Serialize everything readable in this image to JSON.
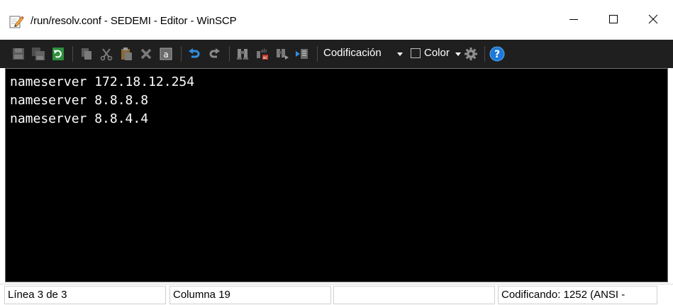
{
  "window": {
    "title": "/run/resolv.conf - SEDEMI - Editor - WinSCP",
    "app_icon": "edit-document-icon",
    "controls": {
      "minimize": "minimize-icon",
      "maximize": "maximize-icon",
      "close": "close-icon"
    }
  },
  "toolbar": {
    "icons": [
      "save-icon",
      "save-all-icon",
      "reload-icon",
      "copy-icon",
      "cut-icon",
      "paste-icon",
      "delete-icon",
      "select-all-icon",
      "undo-icon",
      "redo-icon",
      "find-icon",
      "replace-icon",
      "find-next-icon",
      "goto-line-icon",
      "settings-icon",
      "help-icon"
    ],
    "encoding_label": "Codificación",
    "color_label": "Color",
    "colors": {
      "background": "#1f1f1f",
      "help_blue": "#1e7ad8",
      "reload_green": "#3aa84a"
    }
  },
  "editor": {
    "lines": [
      "nameserver 172.18.12.254",
      "nameserver 8.8.8.8",
      "nameserver 8.8.4.4"
    ],
    "background": "#000000",
    "foreground": "#ffffff"
  },
  "statusbar": {
    "line": "Línea 3 de 3",
    "column": "Columna 19",
    "empty": "",
    "encoding": "Codificando: 1252  (ANSI -"
  }
}
